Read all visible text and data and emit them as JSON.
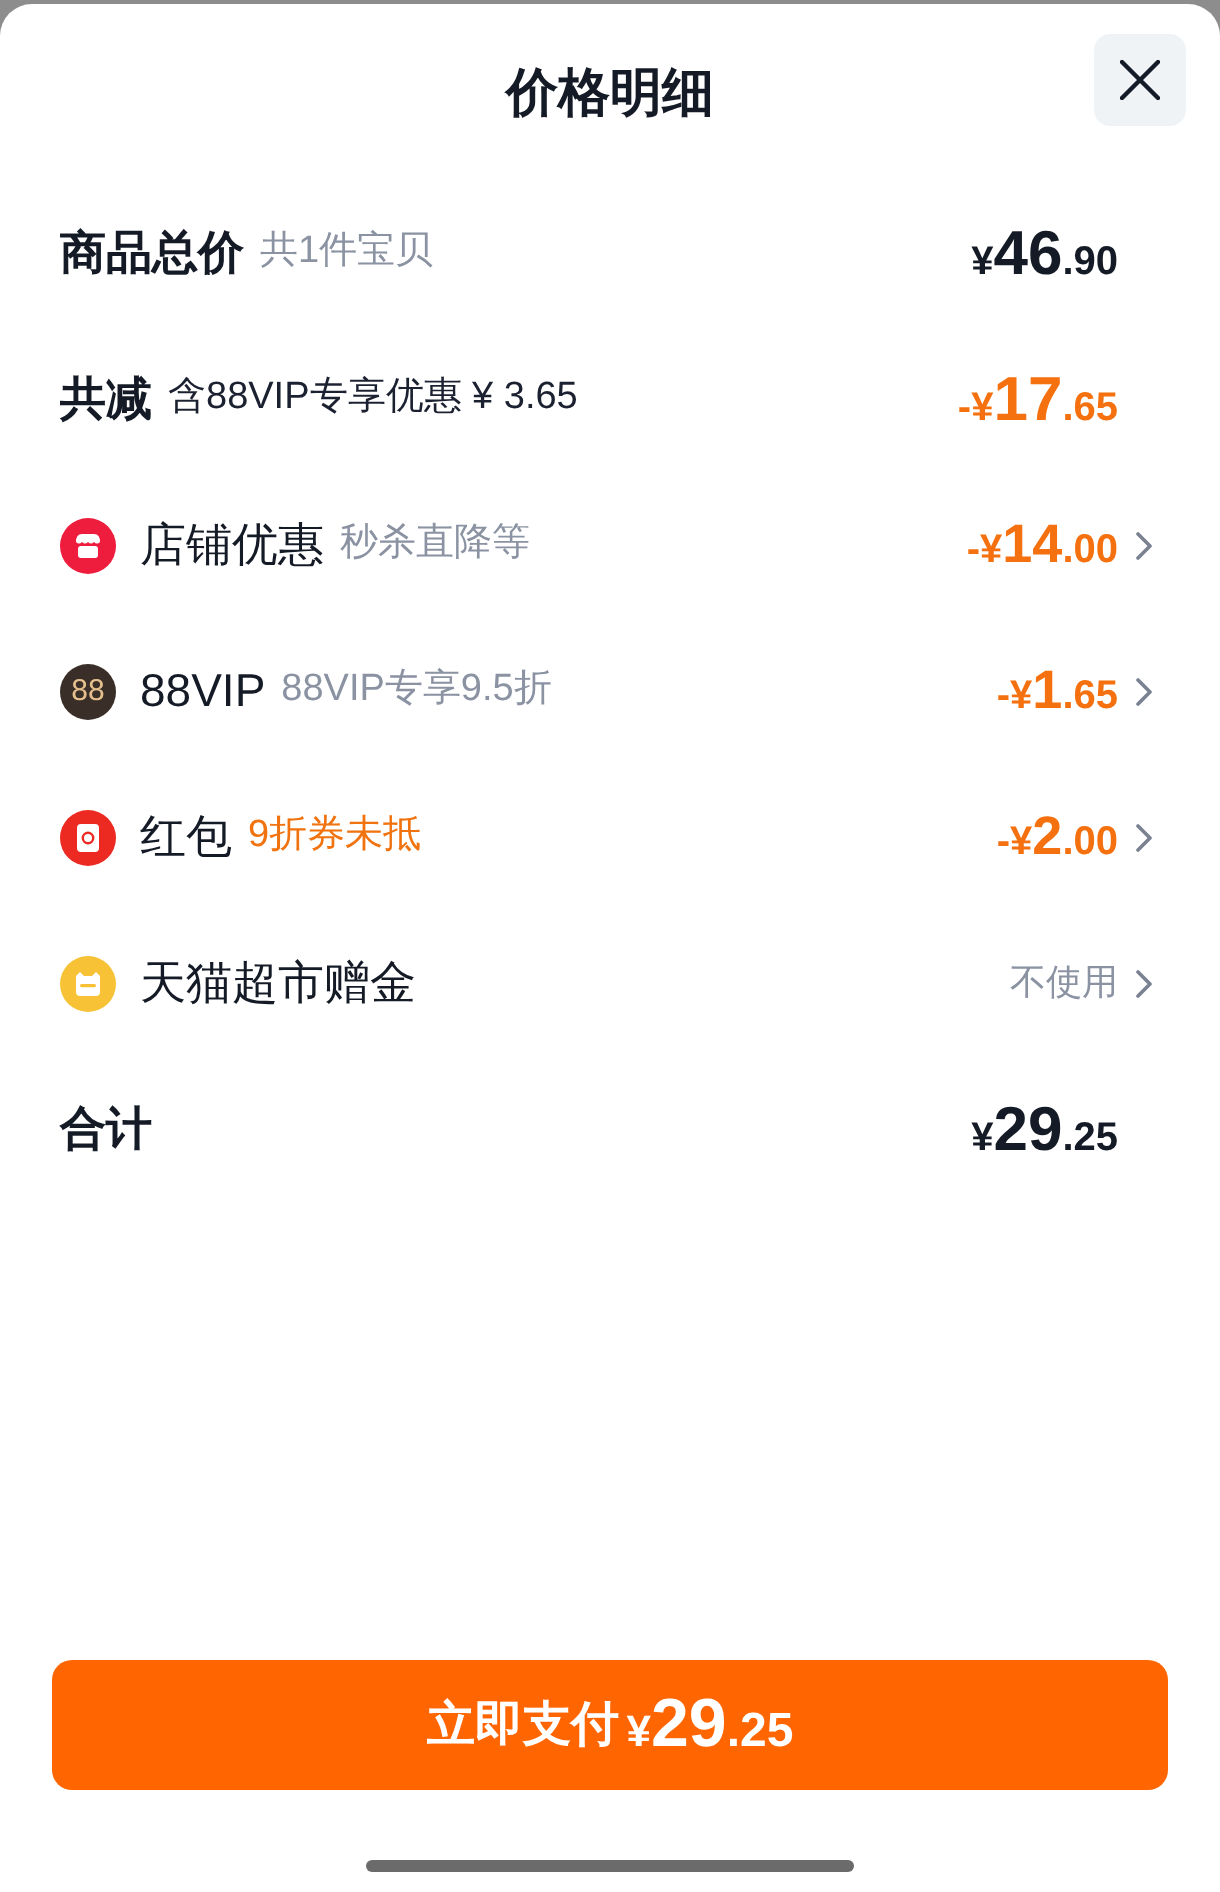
{
  "title": "价格明细",
  "rows": [
    {
      "kind": "plain",
      "label": "商品总价",
      "bold": true,
      "note": {
        "text": "共1件宝贝",
        "color": "#8b93a3"
      },
      "amount": {
        "prefix": "¥",
        "integer": "46",
        "decimal": ".90",
        "color": "#151b26"
      },
      "chevron": false
    },
    {
      "kind": "plain",
      "label": "共减",
      "bold": true,
      "note": {
        "text": "含88VIP专享优惠 ¥ 3.65",
        "color": "#1b2130"
      },
      "amount": {
        "prefix": "-¥",
        "integer": "17",
        "decimal": ".65",
        "color": "#f5700f"
      },
      "chevron": false
    },
    {
      "kind": "store",
      "label": "店铺优惠",
      "bold": false,
      "note": {
        "text": "秒杀直降等",
        "color": "#8b93a3"
      },
      "amount": {
        "prefix": "-¥",
        "integer": "14",
        "decimal": ".00",
        "color": "#f5700f"
      },
      "chevron": true
    },
    {
      "kind": "vip",
      "badge": "88",
      "label": "88VIP",
      "bold": false,
      "note": {
        "text": "88VIP专享9.5折",
        "color": "#8b93a3"
      },
      "amount": {
        "prefix": "-¥",
        "integer": "1",
        "decimal": ".65",
        "color": "#f5700f"
      },
      "chevron": true
    },
    {
      "kind": "red-packet",
      "label": "红包",
      "bold": false,
      "note": {
        "text": "9折券未抵",
        "color": "#f0730f"
      },
      "amount": {
        "prefix": "-¥",
        "integer": "2",
        "decimal": ".00",
        "color": "#f5700f"
      },
      "chevron": true
    },
    {
      "kind": "coupon",
      "label": "天猫超市赠金",
      "bold": false,
      "value": "不使用",
      "chevron": true
    },
    {
      "kind": "plain",
      "label": "合计",
      "bold": true,
      "amount": {
        "prefix": "¥",
        "integer": "29",
        "decimal": ".25",
        "color": "#151b26"
      },
      "chevron": false
    }
  ],
  "pay_button": {
    "label": "立即支付",
    "amount": {
      "prefix": "¥",
      "integer": "29",
      "decimal": ".25"
    }
  }
}
